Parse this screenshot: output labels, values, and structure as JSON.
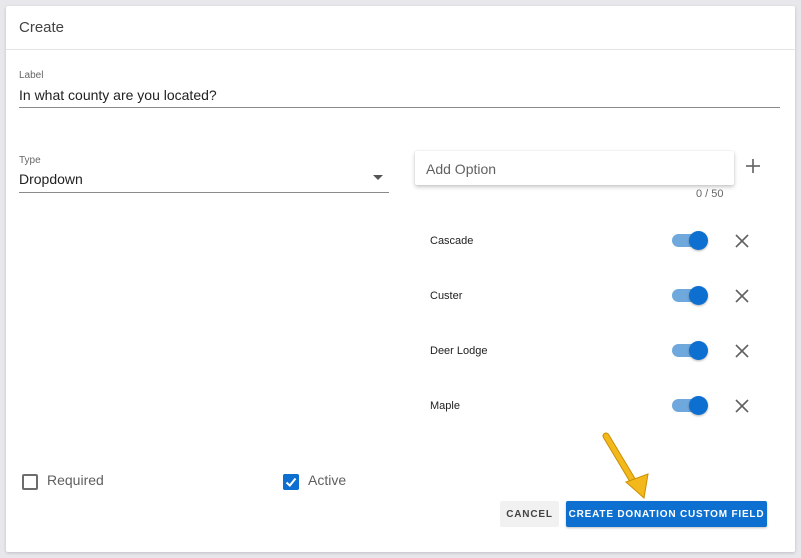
{
  "dialog": {
    "title": "Create"
  },
  "label_field": {
    "label": "Label",
    "value": "In what county are you located?"
  },
  "type_field": {
    "label": "Type",
    "value": "Dropdown",
    "icon": "caret-down-icon"
  },
  "add_option": {
    "placeholder": "Add Option",
    "counter": "0 / 50",
    "add_icon": "plus-icon"
  },
  "options": [
    {
      "label": "Cascade",
      "enabled": true
    },
    {
      "label": "Custer",
      "enabled": true
    },
    {
      "label": "Deer Lodge",
      "enabled": true
    },
    {
      "label": "Maple",
      "enabled": true
    }
  ],
  "flags": {
    "required_label": "Required",
    "required_checked": false,
    "active_label": "Active",
    "active_checked": true
  },
  "actions": {
    "cancel_label": "CANCEL",
    "create_label": "CREATE DONATION CUSTOM FIELD"
  },
  "colors": {
    "primary": "#0d6fcf",
    "switch_track": "#6fa8dc",
    "annotation_arrow": "#f2b81c"
  }
}
